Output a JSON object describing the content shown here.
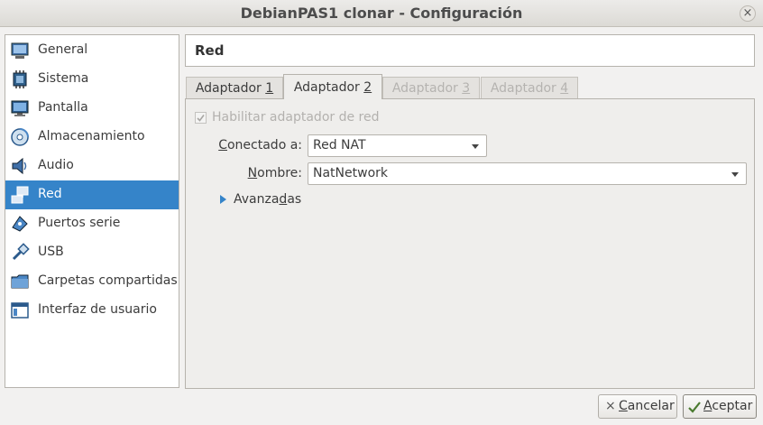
{
  "window": {
    "title": "DebianPAS1 clonar - Configuración",
    "close_glyph": "×"
  },
  "sidebar": {
    "items": [
      {
        "label": "General",
        "icon": "general-icon"
      },
      {
        "label": "Sistema",
        "icon": "chip-icon"
      },
      {
        "label": "Pantalla",
        "icon": "monitor-icon"
      },
      {
        "label": "Almacenamiento",
        "icon": "disk-icon"
      },
      {
        "label": "Audio",
        "icon": "speaker-icon"
      },
      {
        "label": "Red",
        "icon": "network-icon",
        "selected": true
      },
      {
        "label": "Puertos serie",
        "icon": "serial-port-icon"
      },
      {
        "label": "USB",
        "icon": "usb-icon"
      },
      {
        "label": "Carpetas compartidas",
        "icon": "folder-icon"
      },
      {
        "label": "Interfaz de usuario",
        "icon": "ui-window-icon"
      }
    ]
  },
  "section": {
    "title": "Red"
  },
  "tabs": [
    {
      "label_pre": "Adaptador ",
      "label_key": "1",
      "state": "normal"
    },
    {
      "label_pre": "Adaptador ",
      "label_key": "2",
      "state": "active"
    },
    {
      "label_pre": "Adaptador ",
      "label_key": "3",
      "state": "disabled"
    },
    {
      "label_pre": "Adaptador ",
      "label_key": "4",
      "state": "disabled"
    }
  ],
  "adapter": {
    "enable_label": "Habilitar adaptador de red",
    "enable_checked": true,
    "attached_label_key": "C",
    "attached_label_rest": "onectado a:",
    "attached_value": "Red NAT",
    "name_label_key": "N",
    "name_label_rest": "ombre:",
    "name_value": "NatNetwork",
    "advanced_pre": "Avanza",
    "advanced_key": "d",
    "advanced_post": "as"
  },
  "buttons": {
    "cancel_glyph": "×",
    "cancel_key": "C",
    "cancel_rest": "ancelar",
    "accept_key": "A",
    "accept_rest": "ceptar"
  },
  "colors": {
    "accent": "#3584c9",
    "disabled_text": "#b5b3b0"
  }
}
